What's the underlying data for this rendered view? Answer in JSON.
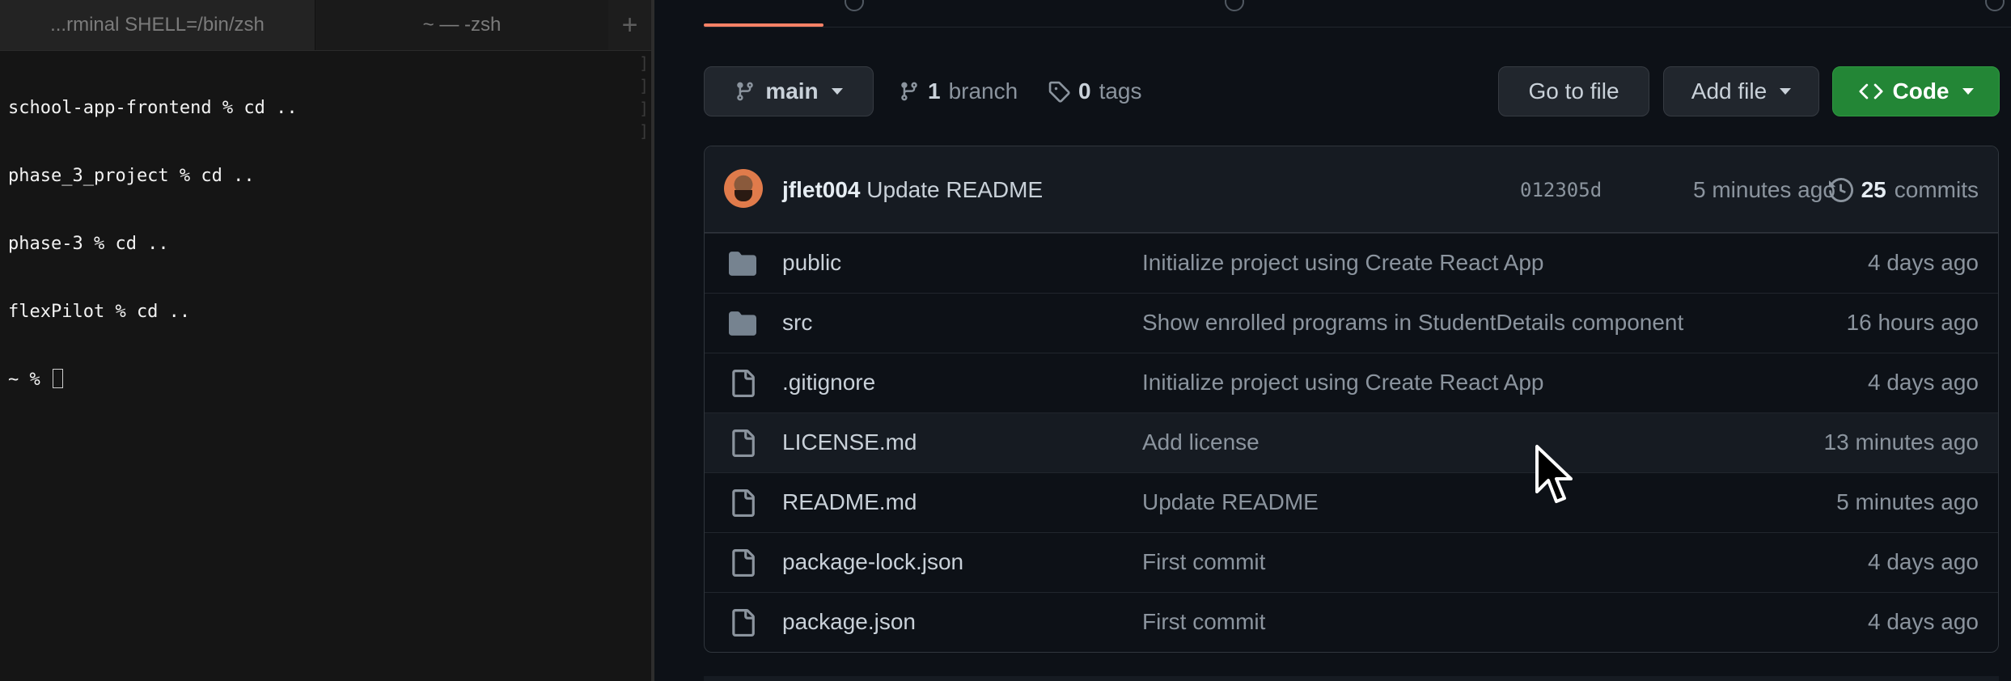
{
  "terminal": {
    "tabs": [
      {
        "label": "...rminal SHELL=/bin/zsh"
      },
      {
        "label": "~ — -zsh"
      }
    ],
    "new_tab_label": "+",
    "lines": [
      "school-app-frontend % cd ..",
      "phase_3_project % cd ..",
      "phase-3 % cd ..",
      "flexPilot % cd ..",
      "~ % "
    ]
  },
  "repo": {
    "branch_selector": {
      "label": "main",
      "icon": "git-branch-icon"
    },
    "branches": {
      "count": "1",
      "label": "branch",
      "icon": "git-branch-icon"
    },
    "tags": {
      "count": "0",
      "label": "tags",
      "icon": "tag-icon"
    },
    "go_to_file_label": "Go to file",
    "add_file_label": "Add file",
    "code_label": "Code",
    "latest_commit": {
      "author": "jflet004",
      "message": "Update README",
      "sha": "012305d",
      "time": "5 minutes ago",
      "commits_count": "25",
      "commits_label": "commits"
    },
    "files": [
      {
        "type": "folder",
        "name": "public",
        "message": "Initialize project using Create React App",
        "age": "4 days ago"
      },
      {
        "type": "folder",
        "name": "src",
        "message": "Show enrolled programs in StudentDetails component",
        "age": "16 hours ago"
      },
      {
        "type": "file",
        "name": ".gitignore",
        "message": "Initialize project using Create React App",
        "age": "4 days ago"
      },
      {
        "type": "file",
        "name": "LICENSE.md",
        "message": "Add license",
        "age": "13 minutes ago"
      },
      {
        "type": "file",
        "name": "README.md",
        "message": "Update README",
        "age": "5 minutes ago"
      },
      {
        "type": "file",
        "name": "package-lock.json",
        "message": "First commit",
        "age": "4 days ago"
      },
      {
        "type": "file",
        "name": "package.json",
        "message": "First commit",
        "age": "4 days ago"
      }
    ]
  },
  "colors": {
    "accent_underline": "#f78166",
    "code_button": "#238636",
    "background": "#0d1117"
  }
}
